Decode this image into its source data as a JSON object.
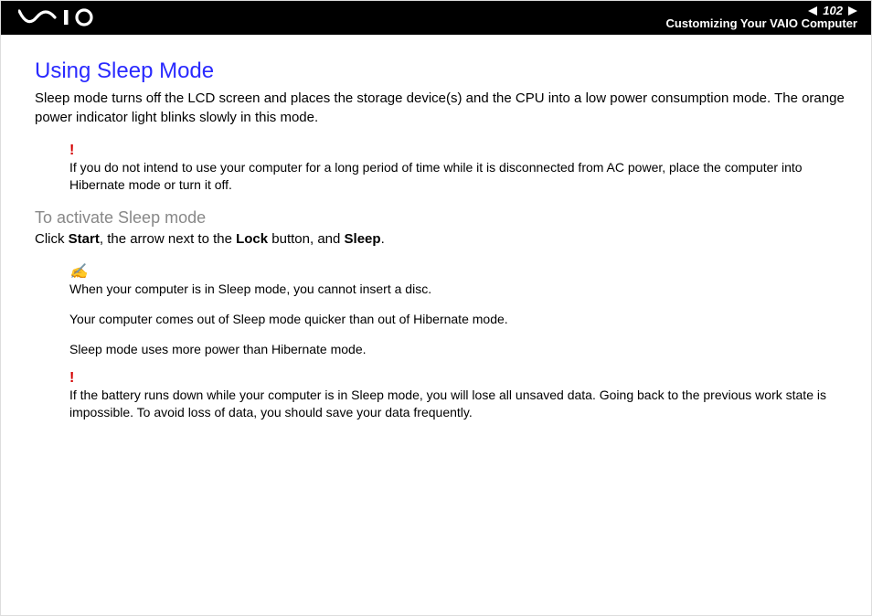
{
  "header": {
    "page_number": "102",
    "breadcrumb": "Customizing Your VAIO Computer"
  },
  "body": {
    "title": "Using Sleep Mode",
    "intro": "Sleep mode turns off the LCD screen and places the storage device(s) and the CPU into a low power consumption mode. The orange power indicator light blinks slowly in this mode.",
    "warning1": "If you do not intend to use your computer for a long period of time while it is disconnected from AC power, place the computer into Hibernate mode or turn it off.",
    "subhead": "To activate Sleep mode",
    "instruction": {
      "pre": "Click ",
      "b1": "Start",
      "mid1": ", the arrow next to the ",
      "b2": "Lock",
      "mid2": " button, and ",
      "b3": "Sleep",
      "post": "."
    },
    "info_notes": [
      "When your computer is in Sleep mode, you cannot insert a disc.",
      "Your computer comes out of Sleep mode quicker than out of Hibernate mode.",
      "Sleep mode uses more power than Hibernate mode."
    ],
    "warning2": "If the battery runs down while your computer is in Sleep mode, you will lose all unsaved data. Going back to the previous work state is impossible. To avoid loss of data, you should save your data frequently."
  }
}
